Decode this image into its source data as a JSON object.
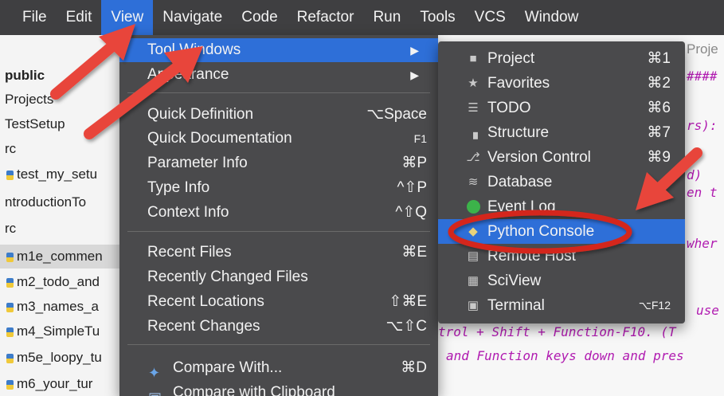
{
  "menubar": {
    "items": [
      "File",
      "Edit",
      "View",
      "Navigate",
      "Code",
      "Refactor",
      "Run",
      "Tools",
      "VCS",
      "Window"
    ],
    "active": "View"
  },
  "project_pane": {
    "rows": [
      {
        "text": "public",
        "py": false
      },
      {
        "text": "Projects",
        "py": false
      },
      {
        "text": "TestSetup",
        "py": false
      },
      {
        "text": "rc",
        "py": false
      },
      {
        "text": "test_my_setu",
        "py": true
      },
      {
        "text": "ntroductionTo",
        "py": false
      },
      {
        "text": "rc",
        "py": false
      },
      {
        "text": "m1e_commen",
        "py": true
      },
      {
        "text": "m2_todo_and",
        "py": true
      },
      {
        "text": "m3_names_a",
        "py": true
      },
      {
        "text": "m4_SimpleTu",
        "py": true
      },
      {
        "text": "m5e_loopy_tu",
        "py": true
      },
      {
        "text": "m6_your_tur",
        "py": true
      }
    ]
  },
  "editor": {
    "tab_fragment": "Proje",
    "lines": [
      "####",
      "rs):",
      "d)",
      "en t",
      "wher",
      "use",
      "trol + Shift + Function-F10.  (T",
      "and Function keys down and pres"
    ]
  },
  "view_menu": {
    "tool_windows": "Tool Windows",
    "appearance": "Appearance",
    "quick_definition": {
      "label": "Quick Definition",
      "shortcut": "⌥Space"
    },
    "quick_documentation": {
      "label": "Quick Documentation",
      "shortcut": "F1"
    },
    "parameter_info": {
      "label": "Parameter Info",
      "shortcut": "⌘P"
    },
    "type_info": {
      "label": "Type Info",
      "shortcut": "^⇧P"
    },
    "context_info": {
      "label": "Context Info",
      "shortcut": "^⇧Q"
    },
    "recent_files": {
      "label": "Recent Files",
      "shortcut": "⌘E"
    },
    "recently_changed_files": {
      "label": "Recently Changed Files",
      "shortcut": ""
    },
    "recent_locations": {
      "label": "Recent Locations",
      "shortcut": "⇧⌘E"
    },
    "recent_changes": {
      "label": "Recent Changes",
      "shortcut": "⌥⇧C"
    },
    "compare_with": {
      "label": "Compare With...",
      "shortcut": "⌘D"
    },
    "compare_with_clipboard": {
      "label": "Compare with Clipboard",
      "shortcut": ""
    }
  },
  "tool_windows_menu": {
    "items": [
      {
        "icon": "folder-icon",
        "label": "Project",
        "shortcut": "⌘1"
      },
      {
        "icon": "star-icon",
        "label": "Favorites",
        "shortcut": "⌘2"
      },
      {
        "icon": "todo-list-icon",
        "label": "TODO",
        "shortcut": "⌘6"
      },
      {
        "icon": "structure-icon",
        "label": "Structure",
        "shortcut": "⌘7"
      },
      {
        "icon": "version-control-icon",
        "label": "Version Control",
        "shortcut": "⌘9"
      },
      {
        "icon": "database-icon",
        "label": "Database",
        "shortcut": ""
      },
      {
        "icon": "event-log-icon",
        "label": "Event Log",
        "shortcut": ""
      },
      {
        "icon": "python-icon",
        "label": "Python Console",
        "shortcut": ""
      },
      {
        "icon": "remote-host-icon",
        "label": "Remote Host",
        "shortcut": ""
      },
      {
        "icon": "sciview-icon",
        "label": "SciView",
        "shortcut": ""
      },
      {
        "icon": "terminal-icon",
        "label": "Terminal",
        "shortcut": "⌥F12"
      }
    ],
    "highlighted": "Python Console"
  },
  "colors": {
    "accent": "#2e6fd8",
    "menu_bg": "#4a4a4c",
    "menubar_bg": "#3f3f41",
    "annotation_red": "#e8453a",
    "code_magenta": "#b01ab0"
  }
}
